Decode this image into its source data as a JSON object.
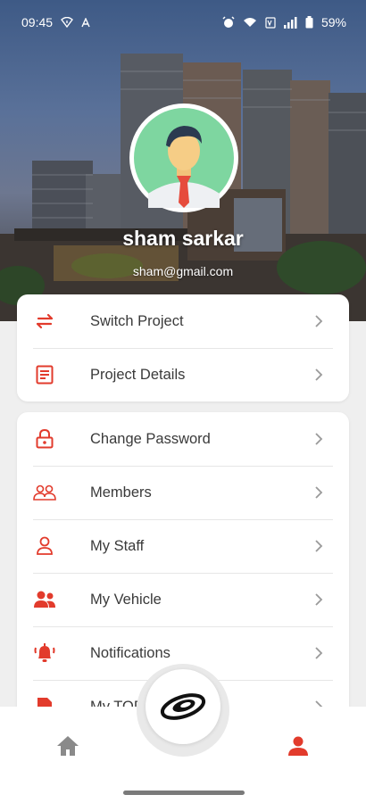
{
  "status_bar": {
    "time": "09:45",
    "left_icons": [
      "wifi-alert-icon",
      "letter-a-icon"
    ],
    "right_icons": [
      "alarm-icon",
      "wifi-icon",
      "volte-icon",
      "signal-icon",
      "battery-icon"
    ],
    "battery": "59%"
  },
  "profile": {
    "name": "sham sarkar",
    "email": "sham@gmail.com"
  },
  "menu_primary": [
    {
      "label": "Switch Project",
      "icon": "swap-arrows-icon"
    },
    {
      "label": "Project Details",
      "icon": "document-icon"
    }
  ],
  "menu_secondary": [
    {
      "label": "Change Password",
      "icon": "lock-icon"
    },
    {
      "label": "Members",
      "icon": "members-icon"
    },
    {
      "label": "My Staff",
      "icon": "staff-icon"
    },
    {
      "label": "My Vehicle",
      "icon": "group-icon"
    },
    {
      "label": "Notifications",
      "icon": "alarm-bell-icon"
    },
    {
      "label": "My TODO",
      "icon": "todo-icon"
    }
  ],
  "bottom_nav": {
    "items": [
      "home-icon",
      "logo-icon",
      "profile-icon"
    ],
    "active": "profile-icon"
  },
  "colors": {
    "accent": "#e23b2c",
    "icon_gray": "#8a8a8a",
    "background": "#efefef"
  }
}
